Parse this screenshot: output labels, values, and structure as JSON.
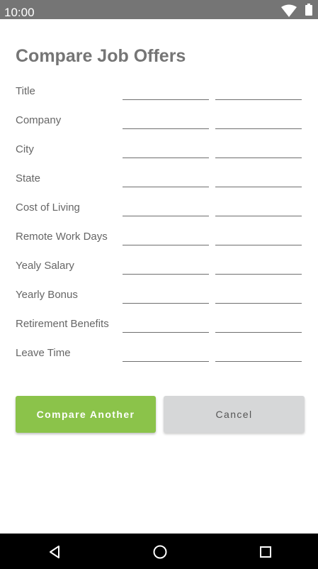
{
  "status_bar": {
    "time": "10:00",
    "wifi_icon": "wifi-icon",
    "battery_icon": "battery-icon",
    "color": "#757575"
  },
  "page": {
    "title": "Compare Job Offers"
  },
  "form": {
    "fields": [
      {
        "label": "Title",
        "value_a": "",
        "value_b": ""
      },
      {
        "label": "Company",
        "value_a": "",
        "value_b": ""
      },
      {
        "label": "City",
        "value_a": "",
        "value_b": ""
      },
      {
        "label": "State",
        "value_a": "",
        "value_b": ""
      },
      {
        "label": "Cost of Living",
        "value_a": "",
        "value_b": ""
      },
      {
        "label": "Remote Work Days",
        "value_a": "",
        "value_b": ""
      },
      {
        "label": "Yealy Salary",
        "value_a": "",
        "value_b": ""
      },
      {
        "label": "Yearly Bonus",
        "value_a": "",
        "value_b": ""
      },
      {
        "label": "Retirement Benefits",
        "value_a": "",
        "value_b": ""
      },
      {
        "label": "Leave Time",
        "value_a": "",
        "value_b": ""
      }
    ]
  },
  "actions": {
    "compare_another_label": "Compare Another",
    "cancel_label": "Cancel",
    "primary_color": "#8bc34a",
    "secondary_color": "#d6d7d8"
  },
  "nav_bar": {
    "back_icon": "back-triangle-icon",
    "home_icon": "home-circle-icon",
    "recent_icon": "recent-apps-square-icon"
  }
}
